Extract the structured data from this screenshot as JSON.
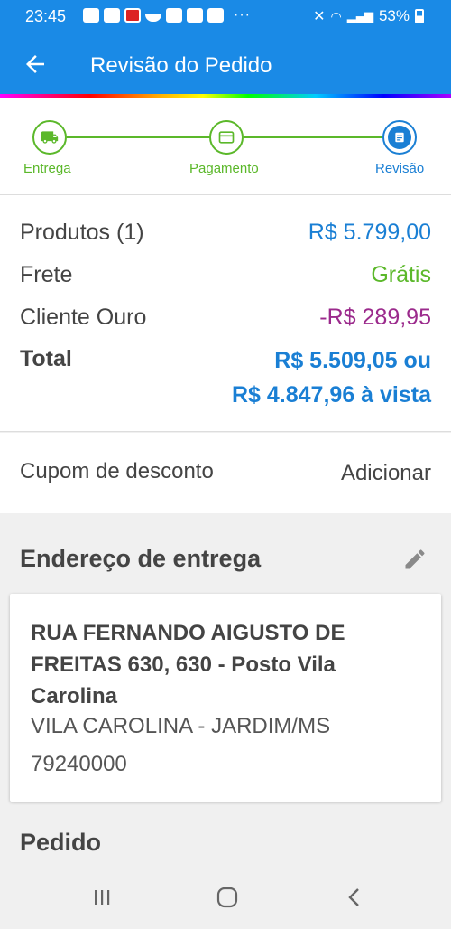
{
  "status_bar": {
    "time": "23:45",
    "battery": "53%",
    "icons": [
      "inter-icon",
      "chat-icon",
      "news-icon",
      "boat-icon",
      "youtube-icon",
      "youtube-icon",
      "youtube-icon",
      "more-dots"
    ]
  },
  "header": {
    "title": "Revisão do Pedido",
    "back_icon": "arrow-left-icon"
  },
  "stepper": {
    "steps": [
      {
        "label": "Entrega",
        "icon": "truck-icon",
        "state": "done"
      },
      {
        "label": "Pagamento",
        "icon": "card-icon",
        "state": "done"
      },
      {
        "label": "Revisão",
        "icon": "list-icon",
        "state": "current"
      }
    ]
  },
  "summary": {
    "products_label": "Produtos (1)",
    "products_value": "R$ 5.799,00",
    "shipping_label": "Frete",
    "shipping_value": "Grátis",
    "gold_label": "Cliente Ouro",
    "gold_value": "-R$ 289,95",
    "total_label": "Total",
    "total_line1": "R$ 5.509,05 ou",
    "total_line2": "R$ 4.847,96 à vista"
  },
  "coupon": {
    "label": "Cupom de desconto",
    "action": "Adicionar"
  },
  "address": {
    "heading": "Endereço de entrega",
    "edit_icon": "pencil-icon",
    "street": "RUA FERNANDO AIGUSTO DE FREITAS 630, 630 - Posto Vila Carolina",
    "city": "VILA CAROLINA - JARDIM/MS",
    "zip": "79240000"
  },
  "order": {
    "heading": "Pedido"
  },
  "colors": {
    "primary": "#1a8ae6",
    "accent_blue": "#1a7fd4",
    "success_green": "#5bb82a",
    "discount_purple": "#9b2a8c"
  },
  "nav": {
    "recents_icon": "recents-icon",
    "home_icon": "home-icon",
    "back_icon": "back-chevron-icon"
  }
}
